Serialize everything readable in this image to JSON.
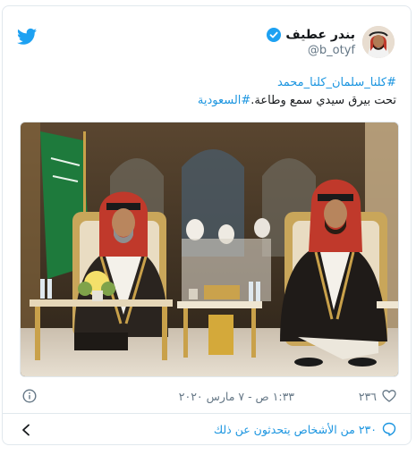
{
  "colors": {
    "twitter_blue": "#1da1f2",
    "link": "#1b95e0",
    "secondary": "#657786",
    "border": "#e1e8ed"
  },
  "author": {
    "display_name": "بندر عطيف",
    "handle": "@b_otyf",
    "verified": true
  },
  "tweet": {
    "hashtag_line": "#كلنا_سلمان_كلنا_محمد",
    "body_text": "تحت بيرق سيدي سمع وطاعة.",
    "body_hashtag": "#السعودية"
  },
  "meta": {
    "timestamp": "١:٣٣ ص - ٧ مارس ٢٠٢٠",
    "like_count": "٢٣٦"
  },
  "footer": {
    "talking_text": "٢٣٠ من الأشخاص يتحدثون عن ذلك"
  },
  "icons": [
    "twitter-bird-icon",
    "verified-badge-icon",
    "info-icon",
    "heart-icon",
    "reply-bubble-icon",
    "chevron-left-icon"
  ]
}
